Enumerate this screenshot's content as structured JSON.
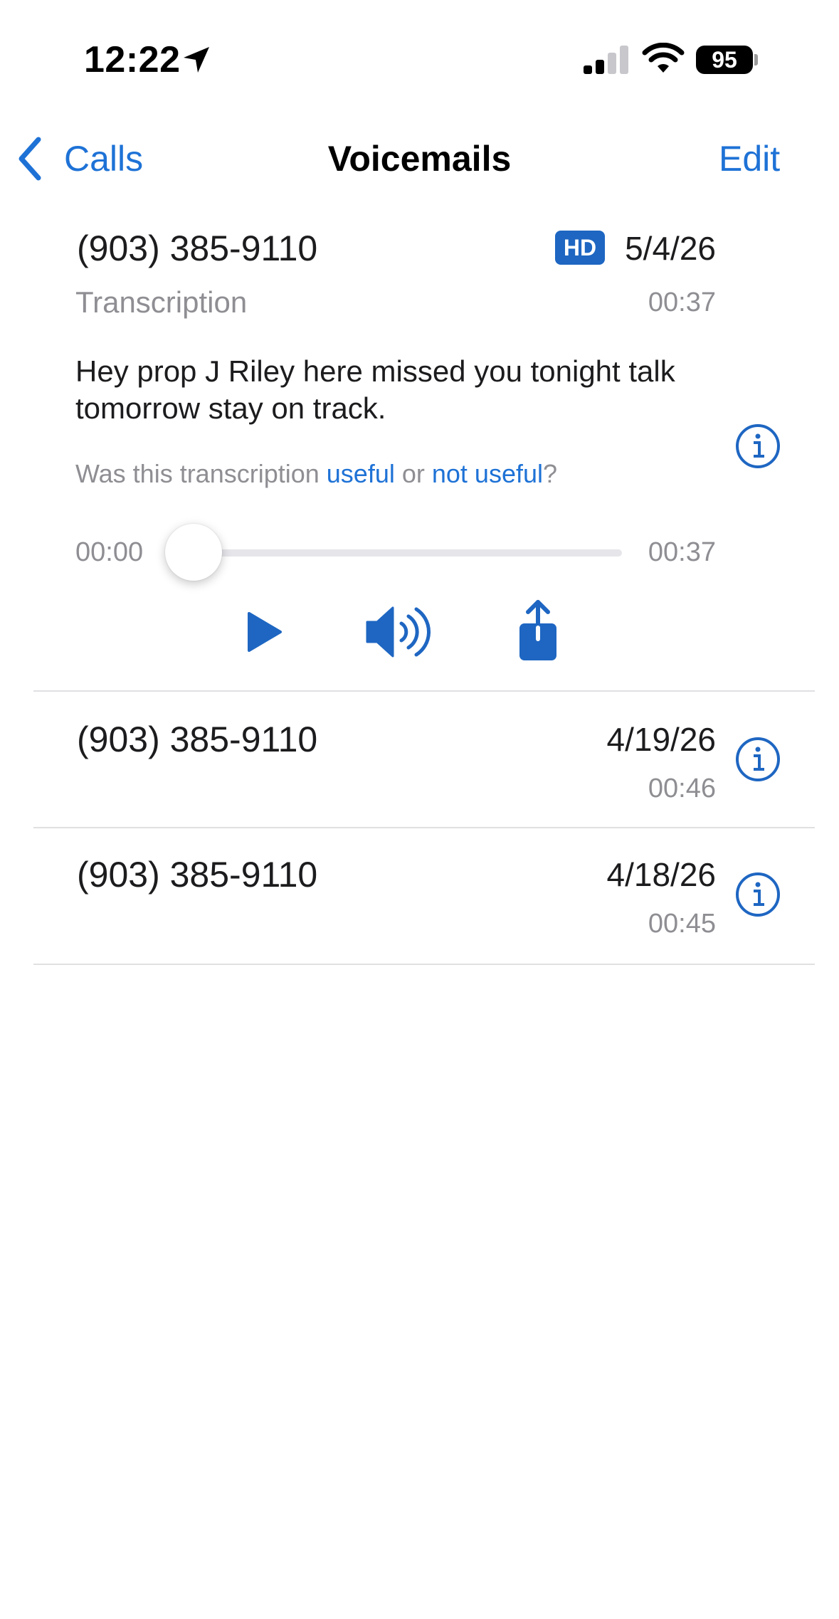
{
  "status_bar": {
    "time": "12:22",
    "battery": "95"
  },
  "nav": {
    "back_label": "Calls",
    "title": "Voicemails",
    "edit_label": "Edit"
  },
  "expanded": {
    "phone": "(903) 385-9110",
    "hd_badge": "HD",
    "date": "5/4/26",
    "transcription_label": "Transcription",
    "duration": "00:37",
    "transcript": "Hey prop J Riley here missed you tonight talk tomorrow stay on track.",
    "feedback": {
      "prefix": "Was this transcription ",
      "useful": "useful",
      "middle": " or ",
      "not_useful": "not useful",
      "suffix": "?"
    },
    "player": {
      "current": "00:00",
      "total": "00:37",
      "progress": 0
    }
  },
  "voicemails": [
    {
      "phone": "(903) 385-9110",
      "date": "4/19/26",
      "duration": "00:46"
    },
    {
      "phone": "(903) 385-9110",
      "date": "4/18/26",
      "duration": "00:45"
    }
  ],
  "colors": {
    "accent": "#1e72d6",
    "hd_badge": "#1e66c2",
    "secondary_text": "#8e8e93"
  },
  "icons": {
    "location": "location-arrow-icon",
    "signal": "cellular-signal-icon",
    "wifi": "wifi-icon",
    "back": "chevron-left-icon",
    "info": "info-circle-icon",
    "play": "play-icon",
    "speaker": "speaker-icon",
    "share": "share-icon"
  }
}
